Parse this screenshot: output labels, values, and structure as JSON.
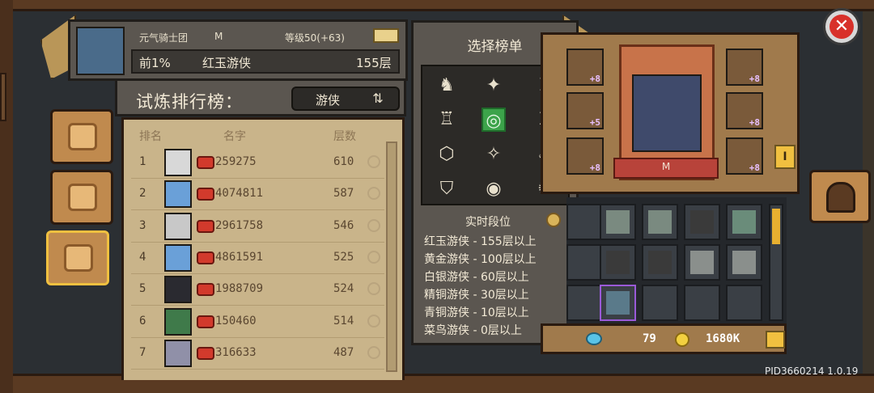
{
  "header": {
    "guild_name": "元气骑士团",
    "guild_tag": "M",
    "level_text": "等级50(+63)",
    "rank_percent": "前1%",
    "rank_tier": "红玉游侠",
    "rank_floors": "155层"
  },
  "board": {
    "title": "试炼排行榜：",
    "class_selected": "游侠",
    "columns": {
      "rank": "排名",
      "name": "名字",
      "floors": "层数"
    },
    "rows": [
      {
        "rank": "1",
        "score": "259275",
        "floors": "610"
      },
      {
        "rank": "2",
        "score": "4074811",
        "floors": "587"
      },
      {
        "rank": "3",
        "score": "2961758",
        "floors": "546"
      },
      {
        "rank": "4",
        "score": "4861591",
        "floors": "525"
      },
      {
        "rank": "5",
        "score": "1988709",
        "floors": "524"
      },
      {
        "rank": "6",
        "score": "150460",
        "floors": "514"
      },
      {
        "rank": "7",
        "score": "316633",
        "floors": "487"
      }
    ]
  },
  "selector": {
    "title": "选择榜单",
    "class_icons": [
      {
        "name": "knight-class-icon",
        "glyph": "♞"
      },
      {
        "name": "star-class-icon",
        "glyph": "✦"
      },
      {
        "name": "tower-class-icon",
        "glyph": "♜"
      },
      {
        "name": "castle-class-icon",
        "glyph": "♖"
      },
      {
        "name": "ranger-class-icon",
        "glyph": "◎",
        "selected": true
      },
      {
        "name": "swords-class-icon",
        "glyph": "⚔"
      },
      {
        "name": "hexagon-class-icon",
        "glyph": "⬡"
      },
      {
        "name": "compass-class-icon",
        "glyph": "✧"
      },
      {
        "name": "flame-class-icon",
        "glyph": "♨"
      },
      {
        "name": "shield-class-icon",
        "glyph": "⛉"
      },
      {
        "name": "swirl-class-icon",
        "glyph": "◉"
      },
      {
        "name": "vortex-class-icon",
        "glyph": "✺"
      }
    ],
    "tier_header": "实时段位",
    "tiers": [
      "红玉游侠 - 155层以上",
      "黄金游侠 - 100层以上",
      "白银游侠 - 60层以上",
      "精铜游侠 - 30层以上",
      "青铜游侠 - 10层以上",
      "菜鸟游侠 - 0层以上"
    ]
  },
  "character": {
    "name": "M",
    "left_slot_badges": [
      "+8",
      "+5",
      "+8"
    ],
    "right_slot_badges": [
      "+8",
      "+8",
      "+8"
    ]
  },
  "inventory": {
    "items": [
      "crossbow",
      "crossbow",
      "bag",
      "bow",
      "bag",
      "bag",
      "blade",
      "blade",
      "bow",
      "orb"
    ]
  },
  "currency": {
    "gems": "79",
    "coins": "1680K"
  },
  "footer": {
    "version": "PID3660214 1.0.19"
  },
  "colors": {
    "accent": "#f0c040",
    "close": "#d8312a",
    "selected_class": "#3ca34a"
  }
}
